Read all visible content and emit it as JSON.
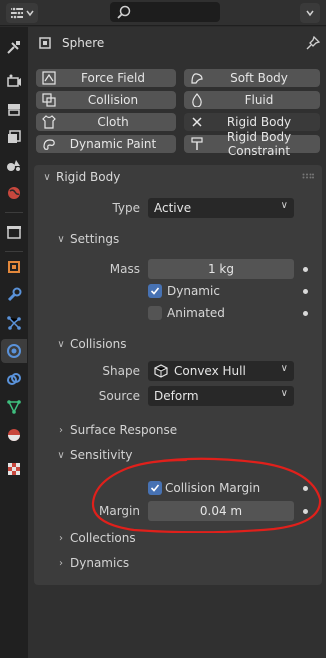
{
  "object": {
    "name": "Sphere"
  },
  "physics_buttons": [
    {
      "label": "Force Field",
      "icon": "force-field-icon"
    },
    {
      "label": "Soft Body",
      "icon": "soft-body-icon"
    },
    {
      "label": "Collision",
      "icon": "collision-icon"
    },
    {
      "label": "Fluid",
      "icon": "fluid-icon"
    },
    {
      "label": "Cloth",
      "icon": "cloth-icon"
    },
    {
      "label": "Rigid Body",
      "icon": "close-icon"
    },
    {
      "label": "Dynamic Paint",
      "icon": "dynamic-paint-icon"
    },
    {
      "label": "Rigid Body Constraint",
      "icon": "rigid-body-constraint-icon"
    }
  ],
  "rigid_body": {
    "title": "Rigid Body",
    "type_label": "Type",
    "type_value": "Active",
    "settings": {
      "title": "Settings",
      "mass_label": "Mass",
      "mass_value": "1 kg",
      "dynamic_label": "Dynamic",
      "animated_label": "Animated"
    },
    "collisions": {
      "title": "Collisions",
      "shape_label": "Shape",
      "shape_value": "Convex Hull",
      "source_label": "Source",
      "source_value": "Deform"
    },
    "surface_response": {
      "title": "Surface Response"
    },
    "sensitivity": {
      "title": "Sensitivity",
      "collision_margin_label": "Collision Margin",
      "margin_label": "Margin",
      "margin_value": "0.04 m"
    },
    "collections": {
      "title": "Collections"
    },
    "dynamics": {
      "title": "Dynamics"
    }
  },
  "colors": {
    "accent_checkbox": "#4772b3",
    "annotation": "#e0201b",
    "physics_tab_active": "#3d3d3d"
  }
}
